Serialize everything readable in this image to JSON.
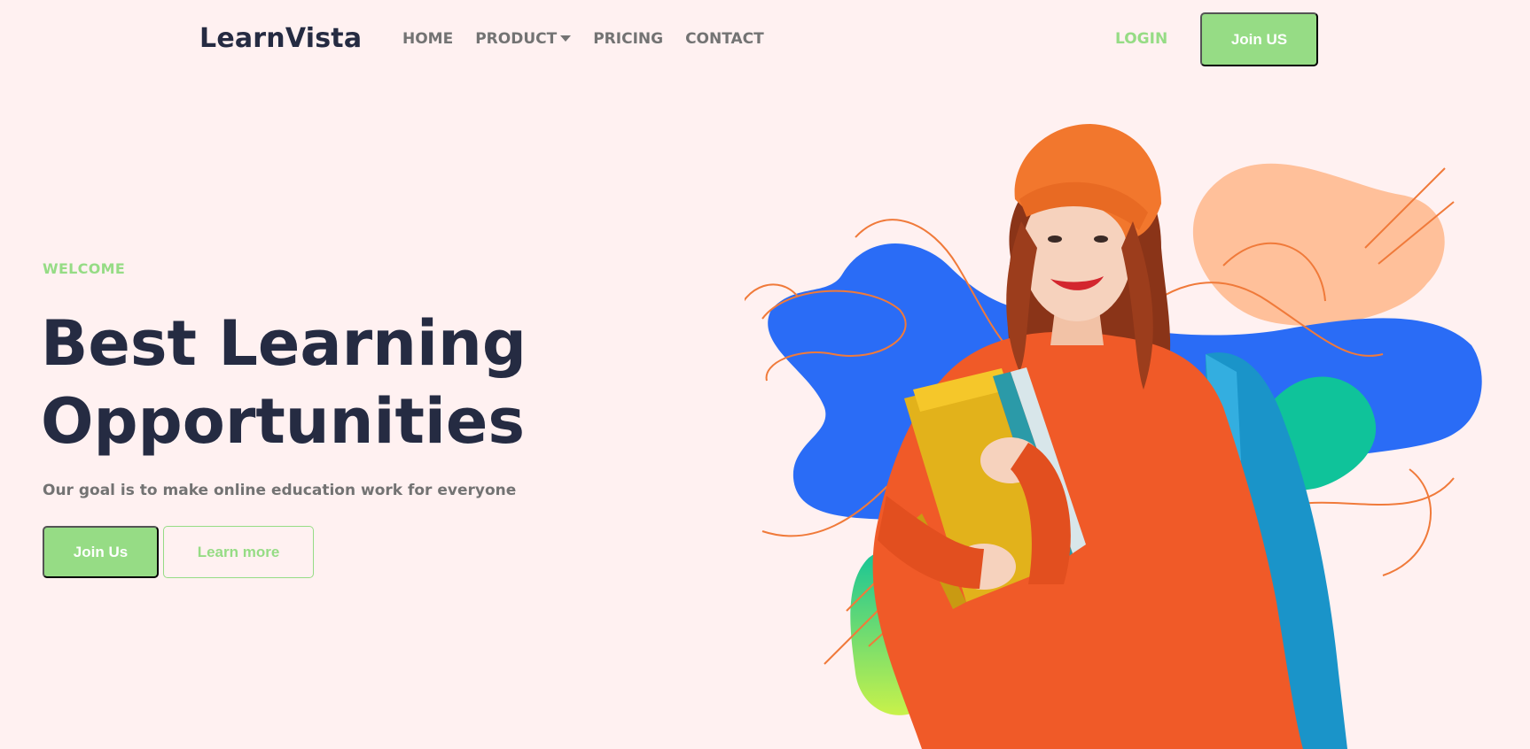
{
  "header": {
    "logo": "LearnVista",
    "nav": [
      {
        "label": "HOME"
      },
      {
        "label": "PRODUCT",
        "has_dropdown": true
      },
      {
        "label": "PRICING"
      },
      {
        "label": "CONTACT"
      }
    ],
    "login_label": "LOGIN",
    "join_label": "Join US"
  },
  "hero": {
    "eyebrow": "WELCOME",
    "title_line1": "Best Learning",
    "title_line2": "Opportunities",
    "subtitle": "Our goal is to make online education work for everyone",
    "primary_cta": "Join Us",
    "secondary_cta": "Learn more"
  },
  "colors": {
    "background": "#fff1f1",
    "accent_green": "#96dc85",
    "heading": "#252b42",
    "muted_text": "#737373",
    "blob_blue": "#2a6cf6",
    "blob_peach": "#ffc09a",
    "blob_teal": "#0fc39a",
    "line_orange": "#f07a3a"
  },
  "illustration": {
    "subject": "smiling student in orange beanie and sweater holding yellow folders with blue backpack",
    "icon": "student-illustration"
  }
}
